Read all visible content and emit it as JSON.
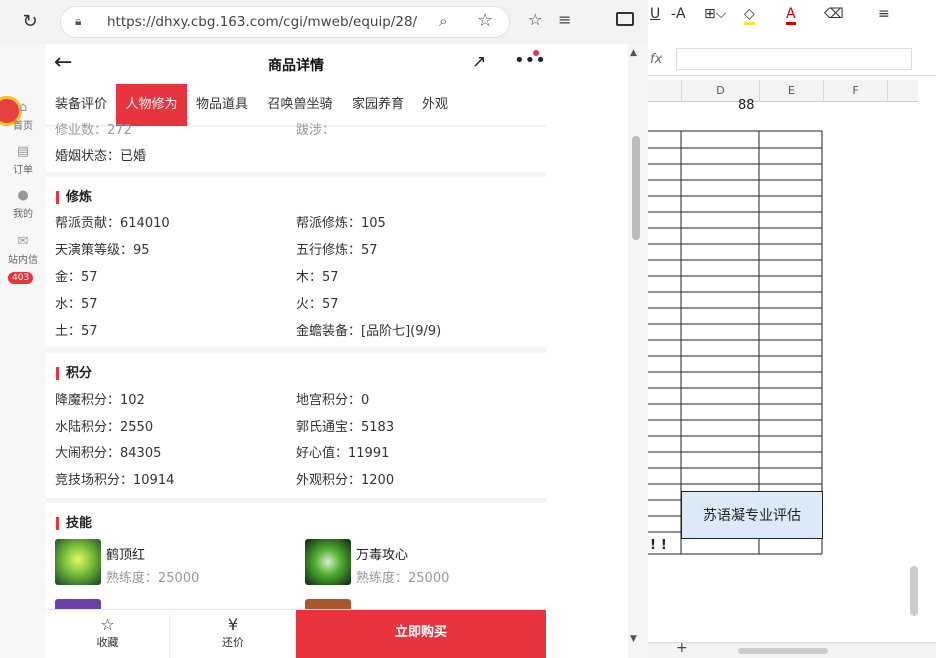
{
  "browser": {
    "url": "https://dhxy.cbg.163.com/cgi/mweb/equip/28/2..."
  },
  "sidebar": {
    "items": [
      {
        "label": "首页",
        "icon": "home-icon"
      },
      {
        "label": "订单",
        "icon": "order-icon"
      },
      {
        "label": "我的",
        "icon": "user-icon"
      },
      {
        "label": "站内信",
        "icon": "mail-icon"
      }
    ],
    "badge": "403"
  },
  "header": {
    "title": "商品详情"
  },
  "tabs": [
    "装备评价",
    "人物修为",
    "物品道具",
    "召唤兽坐骑",
    "家园养育",
    "外观"
  ],
  "active_tab": "人物修为",
  "top_card": {
    "partial_left": "修业数：272",
    "partial_right": "跋涉：",
    "marital_label": "婚姻状态：",
    "marital_value": "已婚"
  },
  "cultivation": {
    "title": "修炼",
    "rows": [
      [
        "帮派贡献：614010",
        "帮派修炼：105"
      ],
      [
        "天演策等级：95",
        "五行修炼：57"
      ],
      [
        "金：57",
        "木：57"
      ],
      [
        "水：57",
        "火：57"
      ],
      [
        "土：57",
        "金蟾装备：[品阶七](9/9)"
      ]
    ]
  },
  "points": {
    "title": "积分",
    "rows": [
      [
        "降魔积分：102",
        "地宫积分：0"
      ],
      [
        "水陆积分：2550",
        "郭氏通宝：5183"
      ],
      [
        "大闹积分：84305",
        "好心值：11991"
      ],
      [
        "竞技场积分：10914",
        "外观积分：1200"
      ]
    ]
  },
  "skills": {
    "title": "技能",
    "items": [
      {
        "name": "鹤顶红",
        "exp": "熟练度：25000",
        "color": "#7cc43b"
      },
      {
        "name": "万毒攻心",
        "exp": "熟练度：25000",
        "color": "#4fae2e"
      }
    ]
  },
  "bottom": {
    "favorite": "收藏",
    "bargain": "还价",
    "buy": "立即购买"
  },
  "sheet": {
    "columns": [
      "D",
      "E",
      "F"
    ],
    "cell_d1": "88",
    "eval_text": "苏语凝专业评估",
    "excl": "!!"
  },
  "colors": {
    "accent": "#e8343e",
    "eval_bg": "#dce9f6"
  }
}
